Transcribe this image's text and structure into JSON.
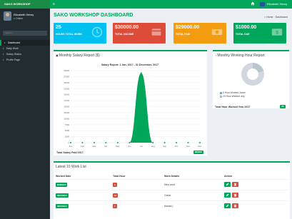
{
  "app": {
    "logo": "SAKO WORKSHOP",
    "hamburger": "≡",
    "user_name": "Elizabeth Henry"
  },
  "sidebar": {
    "user_name": "Elizabeth Henry",
    "status": "Online",
    "search_placeholder": "Search...",
    "items": [
      {
        "label": "Dashboard",
        "icon": "dashboard-icon",
        "active": true
      },
      {
        "label": "Daily Work",
        "icon": "calendar-icon",
        "active": false
      },
      {
        "label": "Salary Status",
        "icon": "money-icon",
        "active": false
      },
      {
        "label": "Profile Page",
        "icon": "user-icon",
        "active": false
      }
    ]
  },
  "page": {
    "title": "SAKO WORKSHOP DASHBOARD",
    "breadcrumb_home": "Home",
    "breadcrumb_current": "Dashboard"
  },
  "cards": [
    {
      "value": "25",
      "label": "HOURS TOTAL WORK",
      "icon": "clock-icon",
      "color": "#00c0ef"
    },
    {
      "value": "$30000.00",
      "label": "TOTAL INCOME",
      "icon": "credit-card-icon",
      "color": "#dd4b39"
    },
    {
      "value": "$29000.00",
      "label": "TOTAL PAID",
      "icon": "money-icon",
      "color": "#f39c12"
    },
    {
      "value": "$1000.00",
      "label": "TOTAL DUE",
      "icon": "money-bill-icon",
      "color": "#00a65a"
    }
  ],
  "salary_panel": {
    "title": "Monthly Salary Report ($)",
    "total_label": "Total Salary Paid 2017",
    "total_value": "$29000"
  },
  "hours_panel": {
    "title": "Monthly Working Hour Report",
    "legend": [
      {
        "label": "5 Hour Worked Junne",
        "color": "#b8c7ce"
      },
      {
        "label": "20 Hour Worked July",
        "color": "#d2d6de"
      }
    ],
    "total_label": "Total Hour Worked Year 2017",
    "total_value": "25"
  },
  "work_panel": {
    "title": "Latest 10 Work List",
    "columns": [
      "Worked Date",
      "Total Hour",
      "Work Details",
      "Action"
    ],
    "rows": [
      {
        "date": "8/28/2017",
        "hours": "5",
        "details": "New work"
      },
      {
        "date": "08/07/2017",
        "hours": "10",
        "details": "Great."
      },
      {
        "date": "08/07/2017",
        "hours": "5",
        "details": "thanks:)"
      }
    ]
  },
  "chart_data": {
    "type": "area",
    "title": "Salary Report: 1 Jan, 2017 - 31 December, 2017",
    "x": [
      "Jan",
      "Feb",
      "Mar",
      "Apr",
      "May",
      "Jun",
      "Jul",
      "Aug",
      "Sep",
      "Oct",
      "Nov",
      "Dec"
    ],
    "series": [
      {
        "values": [
          0,
          0,
          0,
          0,
          0,
          0,
          29000,
          0,
          0,
          0,
          0,
          0
        ],
        "color": "#00a65a"
      }
    ],
    "yticks": [
      0,
      2500,
      5000,
      7500,
      10000,
      12500,
      15000,
      17500,
      20000,
      22500,
      25000,
      27500,
      30000
    ],
    "ylim": [
      0,
      30000
    ],
    "grid": true
  }
}
